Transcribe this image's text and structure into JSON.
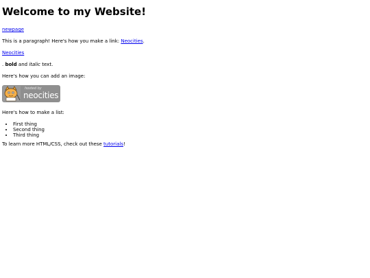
{
  "heading": "Welcome to my Website!",
  "links": {
    "newpage": "newpage",
    "neocities_standalone": "Neocities"
  },
  "paragraph_link": {
    "prefix": "This is a paragraph! Here's how you make a link: ",
    "link_text": "Neocities",
    "suffix": "."
  },
  "formatting": {
    "prefix": ". ",
    "bold": "bold",
    "middle": " and ",
    "italic": "italic",
    "suffix": " text."
  },
  "image_intro": "Here's how you can add an image:",
  "badge": {
    "icon": "neocities-mascot-icon",
    "hosted_text": "hosted by",
    "brand_text": "neocities"
  },
  "list_intro": "Here's how to make a list:",
  "list_items": [
    "First thing",
    "Second thing",
    "Third thing"
  ],
  "learn_more": {
    "prefix": "To learn more HTML/CSS, check out these ",
    "link_text": "tutorials",
    "suffix": "!"
  },
  "colors": {
    "link": "#0000ee",
    "badge_bg": "#8f8f8f",
    "text": "#000000",
    "background": "#ffffff"
  }
}
